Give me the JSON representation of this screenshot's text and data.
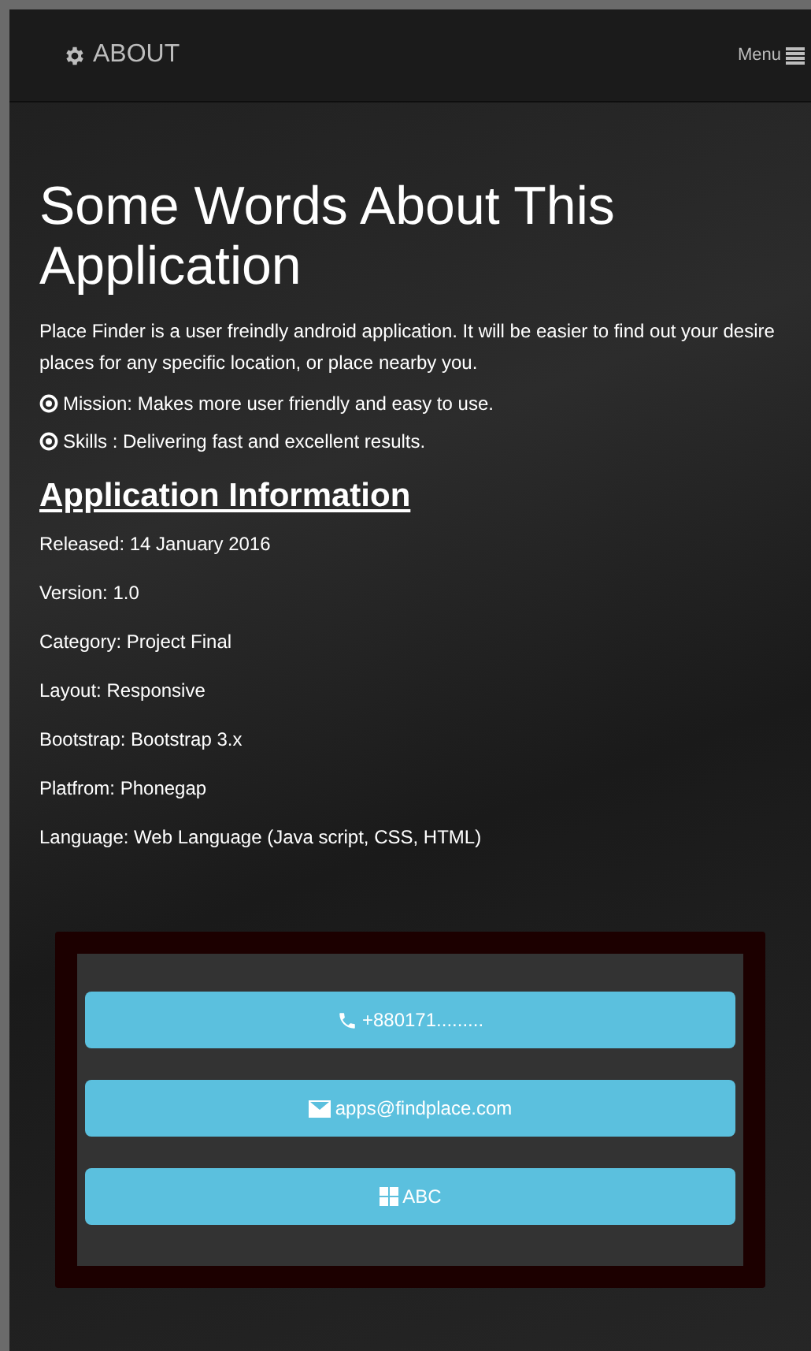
{
  "navbar": {
    "title": "ABOUT",
    "menu_label": "Menu"
  },
  "heading": "Some Words About This Application",
  "intro": "Place Finder is a user freindly android application. It will be easier to find out your desire places for any specific location, or place nearby you.",
  "points": [
    "Mission: Makes more user friendly and easy to use.",
    "Skills : Delivering fast and excellent results."
  ],
  "info_heading": "Application Information",
  "info": [
    "Released: 14 January 2016",
    "Version: 1.0",
    "Category: Project Final",
    "Layout: Responsive",
    "Bootstrap: Bootstrap 3.x",
    "Platfrom: Phonegap",
    "Language: Web Language (Java script, CSS, HTML)"
  ],
  "contact_buttons": [
    {
      "kind": "phone",
      "label": "+880171........."
    },
    {
      "kind": "email",
      "label": "apps@findplace.com"
    },
    {
      "kind": "grid",
      "label": "ABC"
    }
  ]
}
